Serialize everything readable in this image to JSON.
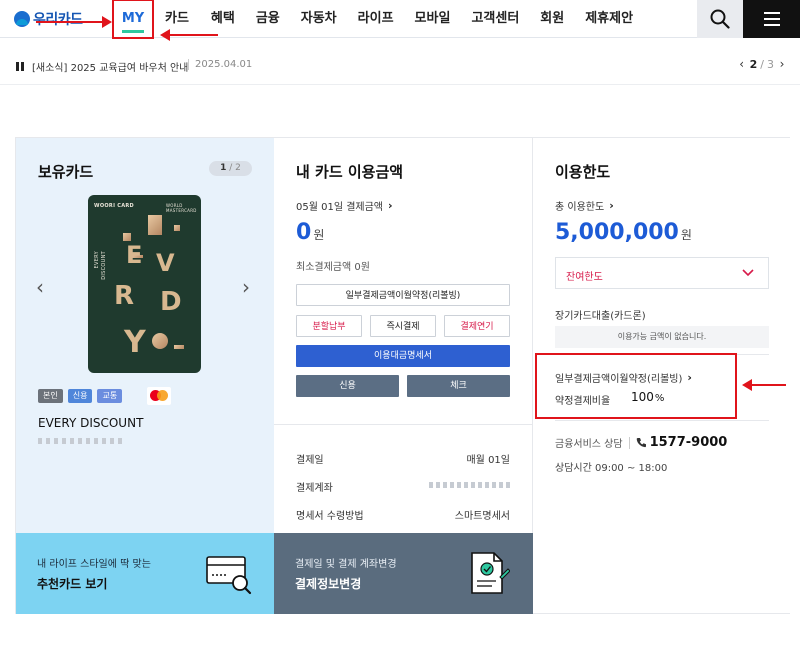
{
  "header": {
    "logo_text": "우리카드",
    "nav": [
      "MY",
      "카드",
      "혜택",
      "금융",
      "자동차",
      "라이프",
      "모바일",
      "고객센터",
      "회원",
      "제휴제안"
    ],
    "search_icon": "search-icon",
    "menu_icon": "hamburger-icon",
    "accent_color": "#1d6ad8"
  },
  "notice": {
    "text": "[새소식] 2025 교육급여 바우처 안내",
    "date": "2025.04.01",
    "page_current": "2",
    "page_sep": "/",
    "page_total": "3"
  },
  "owned_card": {
    "title": "보유카드",
    "page_current": "1",
    "page_total": "/ 2",
    "chips": [
      "본인",
      "신용",
      "교통"
    ],
    "brand_icon": "mastercard-icon",
    "card_name": "EVERY DISCOUNT",
    "card_face": {
      "brand": "WOORI CARD",
      "tag": "WORLD MASTERCARD",
      "line1": "EVERY",
      "line2": "DISCOUNT"
    }
  },
  "usage": {
    "title": "내 카드 이용금액",
    "payment_date_label": "05월 01일 결제금액",
    "amount": "0",
    "amount_unit": "원",
    "min_payment": "최소결제금액 0원",
    "btn_revolving": "일부결제금액이월약정(리볼빙)",
    "btn_installment": "분할납부",
    "btn_instant": "즉시결제",
    "btn_postpone": "결제연기",
    "btn_statement": "이용대금명세서",
    "btn_credit": "신용",
    "btn_check": "체크",
    "info": [
      {
        "label": "결제일",
        "value": "매월 01일"
      },
      {
        "label": "결제계좌",
        "value": ""
      },
      {
        "label": "명세서 수령방법",
        "value": "스마트명세서"
      }
    ]
  },
  "limit": {
    "title": "이용한도",
    "total_label": "총 이용한도",
    "total_amount": "5,000,000",
    "total_unit": "원",
    "remaining_label": "잔여한도",
    "loan_label": "장기카드대출(카드론)",
    "loan_empty": "이용가능 금액이 없습니다.",
    "revolving_label": "일부결제금액이월약정(리볼빙)",
    "revolving_ratio_label": "약정결제비율",
    "revolving_ratio_value": "100",
    "revolving_ratio_unit": "%",
    "support_label": "금융서비스 상담",
    "support_phone": "1577-9000",
    "support_hours": "상담시간 09:00 ~ 18:00"
  },
  "promos": [
    {
      "sub": "내 라이프 스타일에 딱 맞는",
      "main": "추천카드 보기"
    },
    {
      "sub": "결제일 및 결제 계좌변경",
      "main": "결제정보변경"
    }
  ],
  "colors": {
    "annotation_red": "#e0141b",
    "amount_blue": "#1d5bd6",
    "promo_sky": "#7dd3f2",
    "promo_slate": "#5a6c7e"
  }
}
